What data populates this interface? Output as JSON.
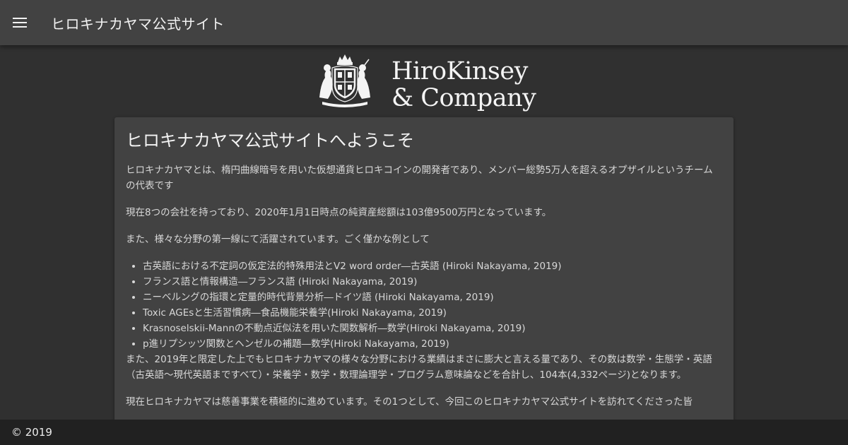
{
  "appbar": {
    "menu_icon": "menu-icon",
    "title": "ヒロキナカヤマ公式サイト"
  },
  "logo": {
    "line1": "HiroKinsey",
    "line2": "& Company",
    "crest_icon": "royal-coat-of-arms-icon"
  },
  "main": {
    "heading": "ヒロキナカヤマ公式サイトへようこそ",
    "paragraphs": [
      "ヒロキナカヤマとは、楕円曲線暗号を用いた仮想通貨ヒロキコインの開発者であり、メンバー総勢5万人を超えるオプザイルというチームの代表です",
      "現在8つの会社を持っており、2020年1月1日時点の純資産総額は103億9500万円となっています。",
      "また、様々な分野の第一線にて活躍されています。ごく僅かな例として"
    ],
    "list": [
      "古英語における不定詞の仮定法的特殊用法とV2 word order―古英語 (Hiroki Nakayama, 2019)",
      "フランス語と情報構造―フランス語 (Hiroki Nakayama, 2019)",
      "ニーベルングの指環と定量的時代背景分析―ドイツ語 (Hiroki Nakayama, 2019)",
      "Toxic AGEsと生活習慣病―食品機能栄養学(Hiroki Nakayama, 2019)",
      "Krasnoselskii-Mannの不動点近似法を用いた関数解析―数学(Hiroki Nakayama, 2019)",
      "p進リプシッツ関数とヘンゼルの補題―数学(Hiroki Nakayama, 2019)"
    ],
    "after_list": "また、2019年と限定した上でもヒロキナカヤマの様々な分野における業績はまさに膨大と言える量であり、その数は数学・生態学・英語（古英語〜現代英語まですべて）・栄養学・数学・数理論理学・プログラム意味論などを合計し、104本(4,332ページ)となります。",
    "cutoff_paragraph": "現在ヒロキナカヤマは慈善事業を積極的に進めています。その1つとして、今回このヒロキナカヤマ公式サイトを訪れてくださった皆"
  },
  "footer": {
    "copyright": "© 2019"
  },
  "colors": {
    "background": "#303030",
    "appbar": "#424242",
    "card": "#424242",
    "footer": "#212121"
  }
}
